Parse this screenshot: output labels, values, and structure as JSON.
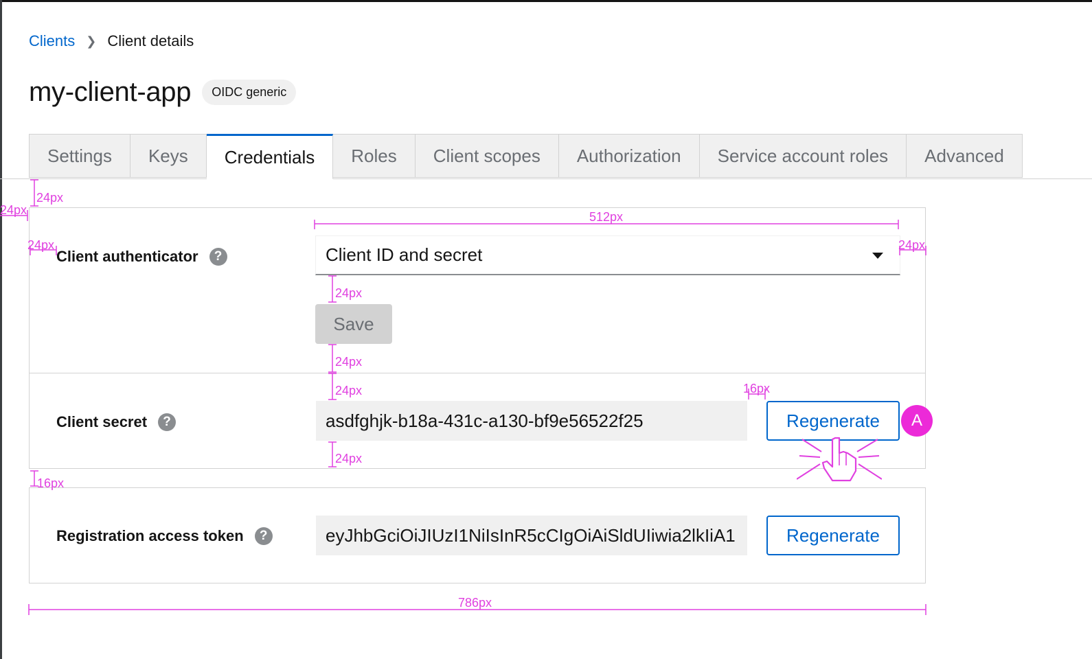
{
  "breadcrumb": {
    "parent": "Clients",
    "current": "Client details"
  },
  "page": {
    "title": "my-client-app",
    "badge": "OIDC generic"
  },
  "tabs": [
    "Settings",
    "Keys",
    "Credentials",
    "Roles",
    "Client scopes",
    "Authorization",
    "Service account roles",
    "Advanced"
  ],
  "active_tab": "Credentials",
  "authenticator": {
    "label": "Client authenticator",
    "value": "Client ID and secret",
    "save_label": "Save"
  },
  "secret": {
    "label": "Client secret",
    "value": "asdfghjk-b18a-431c-a130-bf9e56522f25",
    "button_label": "Regenerate"
  },
  "token": {
    "label": "Registration access token",
    "value": "eyJhbGciOiJIUzI1NiIsInR5cCIgOiAiSldUIiwia2lkIiA1",
    "button_label": "Regenerate"
  },
  "annotations": {
    "marker": "A",
    "spacing": [
      "24px",
      "24px",
      "512px",
      "24px",
      "24px",
      "24px",
      "24px",
      "24px",
      "16px",
      "24px",
      "16px",
      "786px"
    ]
  },
  "colors": {
    "link": "#0066cc",
    "active_tab_border": "#0066cc",
    "annotation": "#e040e0",
    "marker": "#ec2ad8",
    "disabled_button": "#d2d2d2"
  }
}
